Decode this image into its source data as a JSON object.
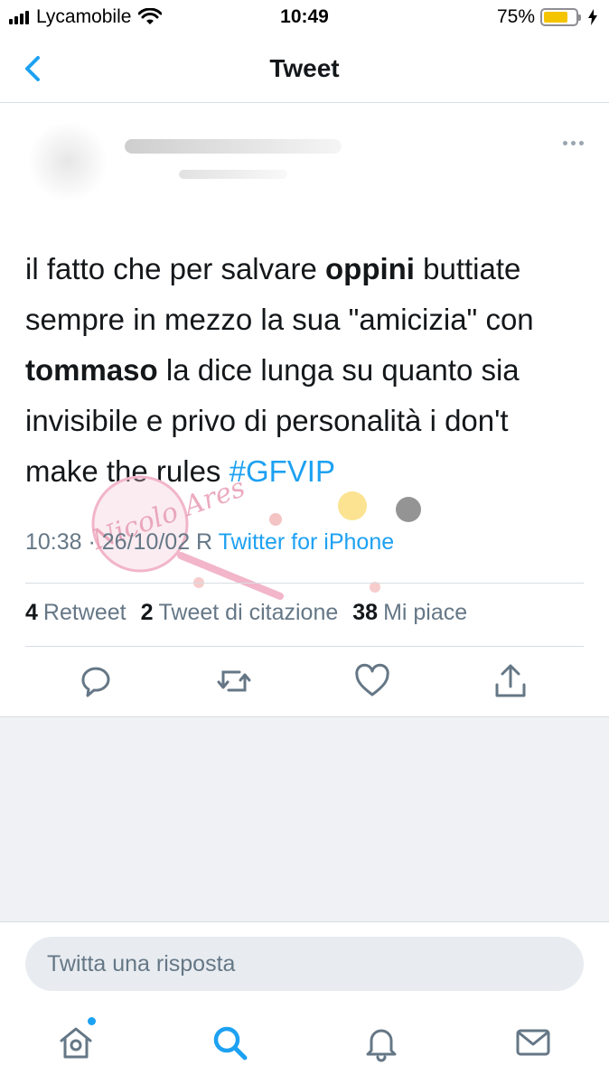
{
  "status_bar": {
    "carrier": "Lycamobile",
    "time": "10:49",
    "battery_pct": "75%",
    "battery_level": 0.75,
    "battery_color": "#f5c400"
  },
  "nav": {
    "title": "Tweet",
    "back_icon": "chevron-left-icon"
  },
  "tweet": {
    "text_1": "il fatto che per salvare ",
    "bold_1": "oppini",
    "text_2": " buttiate sempre in mezzo la sua \"amicizia\" con ",
    "bold_2": "tommaso",
    "text_3": " la dice lunga su quanto sia invisibile e privo di personalità i don't make the rules ",
    "hashtag": "#GFVIP",
    "time": "10:38",
    "sep": " · ",
    "date": "26/10/02 R",
    "client": "Twitter for iPhone"
  },
  "stats": {
    "retweets_count": "4",
    "retweets_label": "Retweet",
    "quotes_count": "2",
    "quotes_label": "Tweet di citazione",
    "likes_count": "38",
    "likes_label": "Mi piace"
  },
  "watermark": {
    "text": "Nicolo Ares"
  },
  "reply": {
    "placeholder": "Twitta una risposta"
  },
  "colors": {
    "accent": "#1da1f2",
    "text": "#14171a",
    "secondary": "#657786"
  },
  "icons": {
    "actions": [
      "reply-icon",
      "retweet-icon",
      "like-icon",
      "share-icon"
    ],
    "tabs": [
      "home-icon",
      "search-icon",
      "notifications-icon",
      "messages-icon"
    ]
  }
}
